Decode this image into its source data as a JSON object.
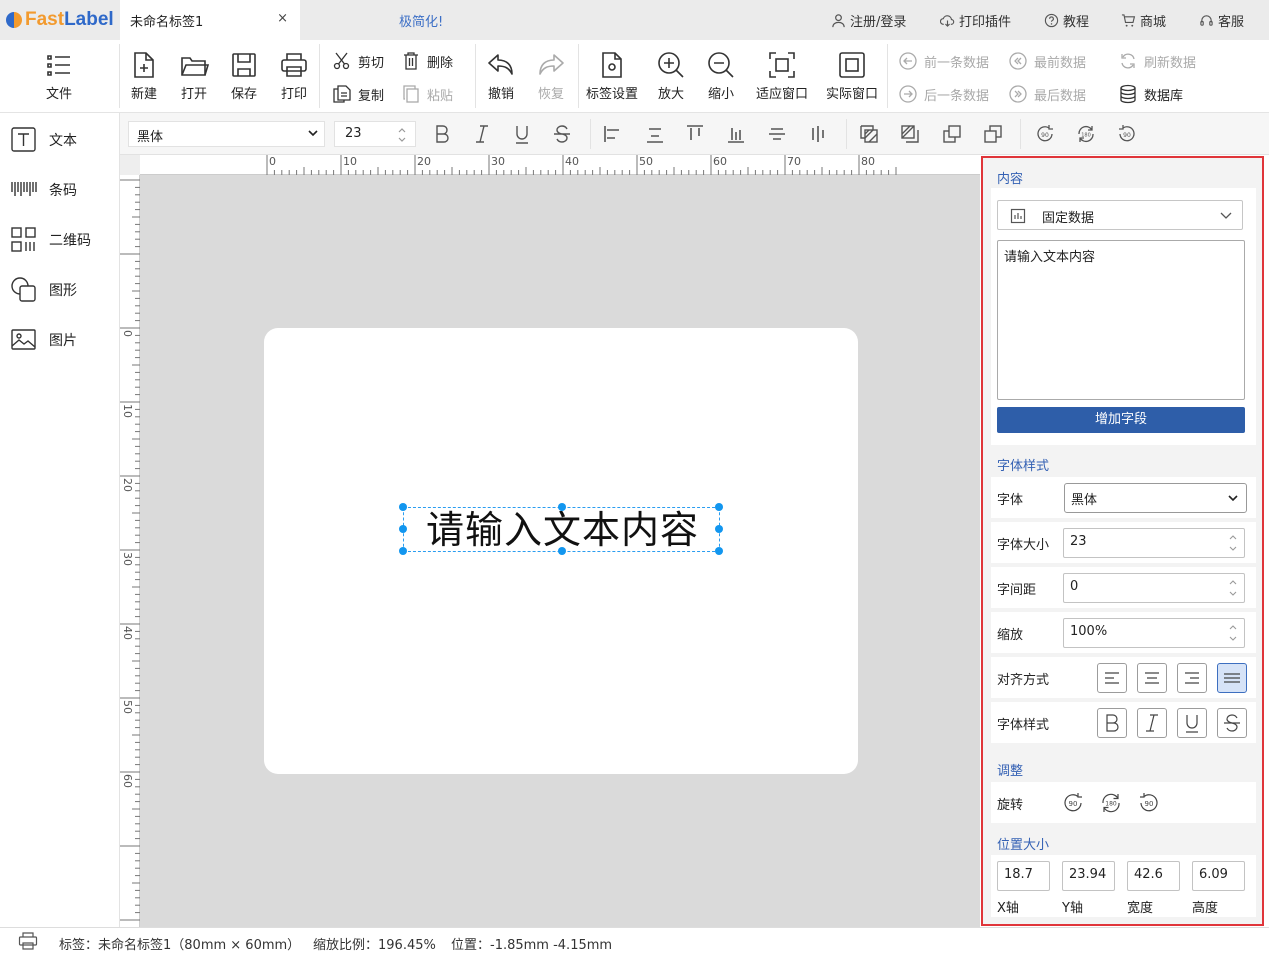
{
  "app": {
    "brand_left": "Fast",
    "brand_right": "Label",
    "doc_tab": "未命名标签1",
    "doc_tab_close": "×",
    "simplify": "极简化!",
    "links": [
      {
        "label": "注册/登录",
        "icon": "user-icon"
      },
      {
        "label": "打印插件",
        "icon": "cloud-download-icon"
      },
      {
        "label": "教程",
        "icon": "help-circle-icon"
      },
      {
        "label": "商城",
        "icon": "cart-icon"
      },
      {
        "label": "客服",
        "icon": "headset-icon"
      }
    ]
  },
  "ribbon": {
    "file": "文件",
    "new": "新建",
    "open": "打开",
    "save": "保存",
    "print": "打印",
    "cut": "剪切",
    "delete": "删除",
    "copy": "复制",
    "paste": "粘贴",
    "undo": "撤销",
    "redo": "恢复",
    "label_settings": "标签设置",
    "zoom_in": "放大",
    "zoom_out": "缩小",
    "fit_window": "适应窗口",
    "actual_window": "实际窗口",
    "prev_record": "前一条数据",
    "first_record": "最前数据",
    "refresh_data": "刷新数据",
    "next_record": "后一条数据",
    "last_record": "最后数据",
    "database": "数据库"
  },
  "format_bar": {
    "font": "黑体",
    "size": "23"
  },
  "sidebar": {
    "items": [
      {
        "label": "文本",
        "icon": "text-icon"
      },
      {
        "label": "条码",
        "icon": "barcode-icon"
      },
      {
        "label": "二维码",
        "icon": "qrcode-icon"
      },
      {
        "label": "图形",
        "icon": "shape-icon"
      },
      {
        "label": "图片",
        "icon": "image-icon"
      }
    ]
  },
  "ruler": {
    "h_labels": [
      "0",
      "10",
      "20",
      "30",
      "40",
      "50",
      "60",
      "70",
      "80"
    ],
    "v_labels": [
      "0",
      "10",
      "20",
      "30",
      "40",
      "50",
      "60"
    ]
  },
  "canvas": {
    "text": "请输入文本内容"
  },
  "panel": {
    "content_head": "内容",
    "data_source": "固定数据",
    "text_content": "请输入文本内容",
    "add_field": "增加字段",
    "font_style_head": "字体样式",
    "font_label": "字体",
    "font_value": "黑体",
    "font_size_label": "字体大小",
    "font_size_value": "23",
    "spacing_label": "字间距",
    "spacing_value": "0",
    "scale_label": "缩放",
    "scale_value": "100%",
    "align_label": "对齐方式",
    "style_label": "字体样式",
    "adjust_head": "调整",
    "rotate_label": "旋转",
    "rotate_options": [
      "90",
      "180",
      "90"
    ],
    "pos_head": "位置大小",
    "x_value": "18.7",
    "y_value": "23.94",
    "w_value": "42.6",
    "h_value": "6.09",
    "x_label": "X轴",
    "y_label": "Y轴",
    "w_label": "宽度",
    "h_label": "高度",
    "active_align": "justify"
  },
  "status": {
    "label_info": "标签：未命名标签1（80mm × 60mm）",
    "zoom": "缩放比例：196.45%",
    "position": "位置：-1.85mm -4.15mm"
  },
  "colors": {
    "accent": "#2e5ea9",
    "highlight_border": "#e0353a",
    "selection": "#1296ef"
  }
}
